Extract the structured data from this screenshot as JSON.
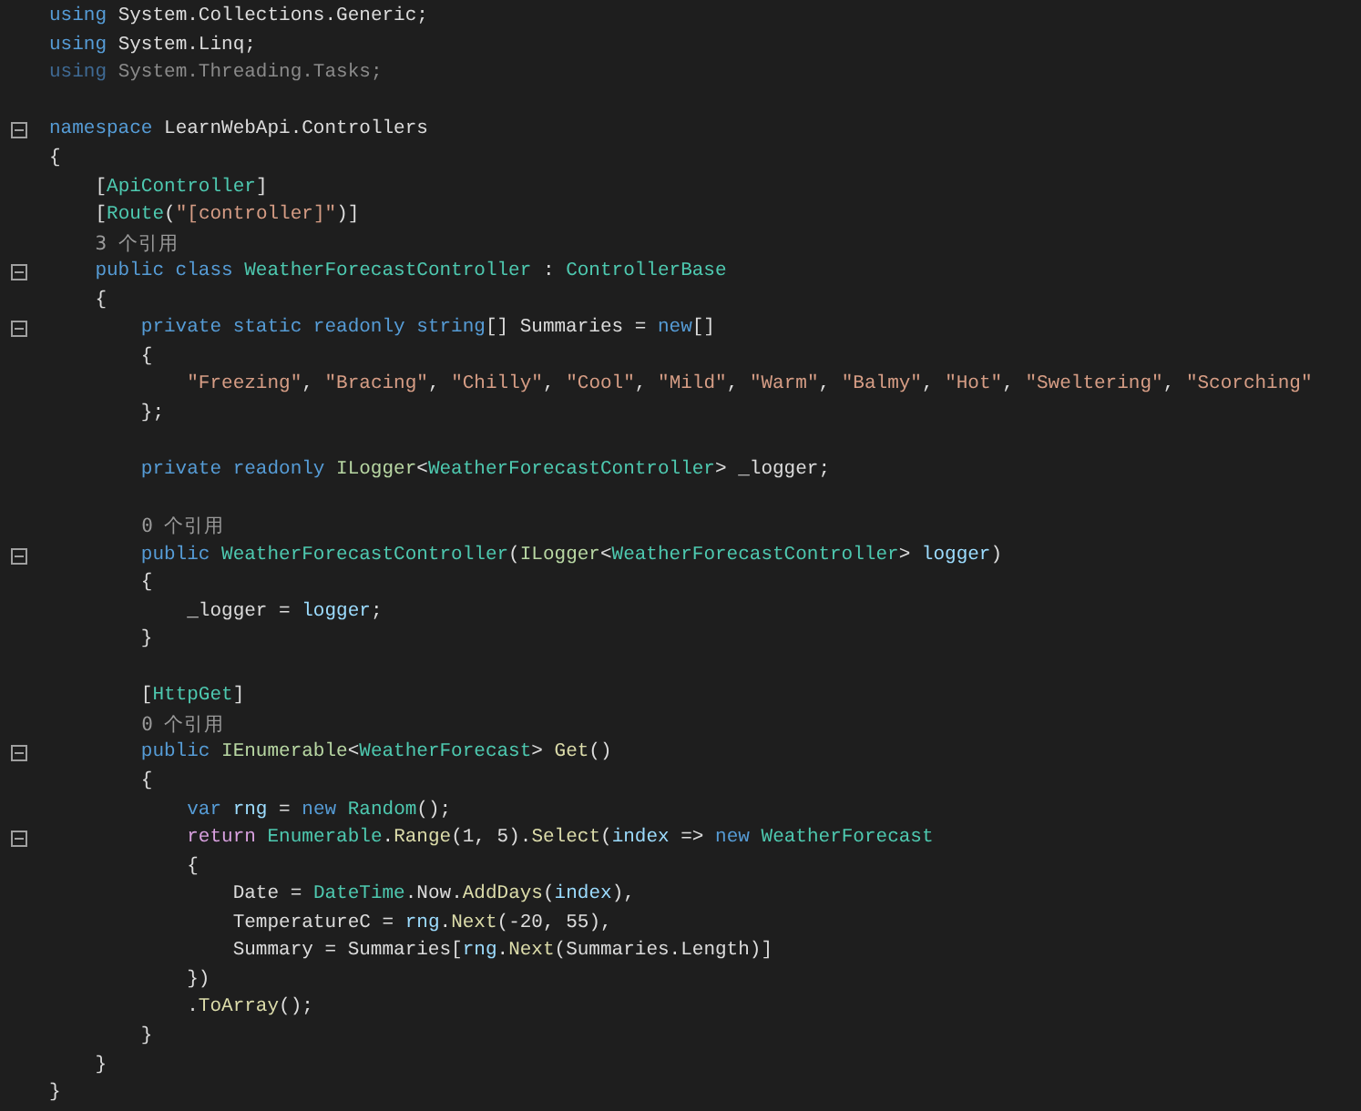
{
  "editor": {
    "lines": [
      {
        "kind": "code",
        "fold": false,
        "tokens": [
          {
            "text": "using",
            "kind": "kw"
          },
          {
            "text": " System.Collections.Generic;",
            "kind": "plain"
          }
        ]
      },
      {
        "kind": "code",
        "fold": false,
        "tokens": [
          {
            "text": "using",
            "kind": "kw"
          },
          {
            "text": " System.Linq;",
            "kind": "plain"
          }
        ]
      },
      {
        "kind": "code",
        "fold": false,
        "tokens": [
          {
            "text": "using",
            "kind": "dimkw"
          },
          {
            "text": " System.Threading.Tasks;",
            "kind": "dim"
          }
        ]
      },
      {
        "kind": "blank",
        "fold": false
      },
      {
        "kind": "code",
        "fold": true,
        "tokens": [
          {
            "text": "namespace",
            "kind": "kw"
          },
          {
            "text": " LearnWebApi.Controllers",
            "kind": "plain"
          }
        ]
      },
      {
        "kind": "code",
        "fold": false,
        "tokens": [
          {
            "text": "{",
            "kind": "plain"
          }
        ]
      },
      {
        "kind": "code",
        "fold": false,
        "tokens": [
          {
            "text": "    [",
            "kind": "plain"
          },
          {
            "text": "ApiController",
            "kind": "type"
          },
          {
            "text": "]",
            "kind": "plain"
          }
        ]
      },
      {
        "kind": "code",
        "fold": false,
        "tokens": [
          {
            "text": "    [",
            "kind": "plain"
          },
          {
            "text": "Route",
            "kind": "type"
          },
          {
            "text": "(",
            "kind": "plain"
          },
          {
            "text": "\"[controller]\"",
            "kind": "str"
          },
          {
            "text": ")]",
            "kind": "plain"
          }
        ]
      },
      {
        "kind": "codelens",
        "fold": false,
        "text": "    3 个引用"
      },
      {
        "kind": "code",
        "fold": true,
        "tokens": [
          {
            "text": "    public class ",
            "kind": "kw"
          },
          {
            "text": "WeatherForecastController",
            "kind": "type"
          },
          {
            "text": " : ",
            "kind": "plain"
          },
          {
            "text": "ControllerBase",
            "kind": "type"
          }
        ]
      },
      {
        "kind": "code",
        "fold": false,
        "tokens": [
          {
            "text": "    {",
            "kind": "plain"
          }
        ]
      },
      {
        "kind": "code",
        "fold": true,
        "tokens": [
          {
            "text": "        private static readonly string",
            "kind": "kw"
          },
          {
            "text": "[] Summaries = ",
            "kind": "plain"
          },
          {
            "text": "new",
            "kind": "kw"
          },
          {
            "text": "[]",
            "kind": "plain"
          }
        ]
      },
      {
        "kind": "code",
        "fold": false,
        "tokens": [
          {
            "text": "        {",
            "kind": "plain"
          }
        ]
      },
      {
        "kind": "code",
        "fold": false,
        "tokens": [
          {
            "text": "            \"Freezing\"",
            "kind": "str"
          },
          {
            "text": ", ",
            "kind": "plain"
          },
          {
            "text": "\"Bracing\"",
            "kind": "str"
          },
          {
            "text": ", ",
            "kind": "plain"
          },
          {
            "text": "\"Chilly\"",
            "kind": "str"
          },
          {
            "text": ", ",
            "kind": "plain"
          },
          {
            "text": "\"Cool\"",
            "kind": "str"
          },
          {
            "text": ", ",
            "kind": "plain"
          },
          {
            "text": "\"Mild\"",
            "kind": "str"
          },
          {
            "text": ", ",
            "kind": "plain"
          },
          {
            "text": "\"Warm\"",
            "kind": "str"
          },
          {
            "text": ", ",
            "kind": "plain"
          },
          {
            "text": "\"Balmy\"",
            "kind": "str"
          },
          {
            "text": ", ",
            "kind": "plain"
          },
          {
            "text": "\"Hot\"",
            "kind": "str"
          },
          {
            "text": ", ",
            "kind": "plain"
          },
          {
            "text": "\"Sweltering\"",
            "kind": "str"
          },
          {
            "text": ", ",
            "kind": "plain"
          },
          {
            "text": "\"Scorching\"",
            "kind": "str"
          }
        ]
      },
      {
        "kind": "code",
        "fold": false,
        "tokens": [
          {
            "text": "        };",
            "kind": "plain"
          }
        ]
      },
      {
        "kind": "blank",
        "fold": false
      },
      {
        "kind": "code",
        "fold": false,
        "tokens": [
          {
            "text": "        private readonly ",
            "kind": "kw"
          },
          {
            "text": "ILogger",
            "kind": "iface"
          },
          {
            "text": "<",
            "kind": "plain"
          },
          {
            "text": "WeatherForecastController",
            "kind": "type"
          },
          {
            "text": "> _logger;",
            "kind": "plain"
          }
        ]
      },
      {
        "kind": "blank",
        "fold": false
      },
      {
        "kind": "codelens",
        "fold": false,
        "text": "        0 个引用"
      },
      {
        "kind": "code",
        "fold": true,
        "tokens": [
          {
            "text": "        public ",
            "kind": "kw"
          },
          {
            "text": "WeatherForecastController",
            "kind": "type"
          },
          {
            "text": "(",
            "kind": "plain"
          },
          {
            "text": "ILogger",
            "kind": "iface"
          },
          {
            "text": "<",
            "kind": "plain"
          },
          {
            "text": "WeatherForecastController",
            "kind": "type"
          },
          {
            "text": "> ",
            "kind": "plain"
          },
          {
            "text": "logger",
            "kind": "param"
          },
          {
            "text": ")",
            "kind": "plain"
          }
        ]
      },
      {
        "kind": "code",
        "fold": false,
        "tokens": [
          {
            "text": "        {",
            "kind": "plain"
          }
        ]
      },
      {
        "kind": "code",
        "fold": false,
        "tokens": [
          {
            "text": "            _logger = ",
            "kind": "plain"
          },
          {
            "text": "logger",
            "kind": "param"
          },
          {
            "text": ";",
            "kind": "plain"
          }
        ]
      },
      {
        "kind": "code",
        "fold": false,
        "tokens": [
          {
            "text": "        }",
            "kind": "plain"
          }
        ]
      },
      {
        "kind": "blank",
        "fold": false
      },
      {
        "kind": "code",
        "fold": false,
        "tokens": [
          {
            "text": "        [",
            "kind": "plain"
          },
          {
            "text": "HttpGet",
            "kind": "type"
          },
          {
            "text": "]",
            "kind": "plain"
          }
        ]
      },
      {
        "kind": "codelens",
        "fold": false,
        "text": "        0 个引用"
      },
      {
        "kind": "code",
        "fold": true,
        "tokens": [
          {
            "text": "        public ",
            "kind": "kw"
          },
          {
            "text": "IEnumerable",
            "kind": "iface"
          },
          {
            "text": "<",
            "kind": "plain"
          },
          {
            "text": "WeatherForecast",
            "kind": "type"
          },
          {
            "text": "> ",
            "kind": "plain"
          },
          {
            "text": "Get",
            "kind": "method"
          },
          {
            "text": "()",
            "kind": "plain"
          }
        ]
      },
      {
        "kind": "code",
        "fold": false,
        "tokens": [
          {
            "text": "        {",
            "kind": "plain"
          }
        ]
      },
      {
        "kind": "code",
        "fold": false,
        "tokens": [
          {
            "text": "            var ",
            "kind": "kw"
          },
          {
            "text": "rng",
            "kind": "param"
          },
          {
            "text": " = ",
            "kind": "plain"
          },
          {
            "text": "new ",
            "kind": "kw"
          },
          {
            "text": "Random",
            "kind": "type"
          },
          {
            "text": "();",
            "kind": "plain"
          }
        ]
      },
      {
        "kind": "code",
        "fold": true,
        "tokens": [
          {
            "text": "            return ",
            "kind": "ctrl"
          },
          {
            "text": "Enumerable",
            "kind": "type"
          },
          {
            "text": ".",
            "kind": "plain"
          },
          {
            "text": "Range",
            "kind": "method"
          },
          {
            "text": "(1, 5).",
            "kind": "plain"
          },
          {
            "text": "Select",
            "kind": "method"
          },
          {
            "text": "(",
            "kind": "plain"
          },
          {
            "text": "index",
            "kind": "param"
          },
          {
            "text": " => ",
            "kind": "plain"
          },
          {
            "text": "new ",
            "kind": "kw"
          },
          {
            "text": "WeatherForecast",
            "kind": "type"
          }
        ]
      },
      {
        "kind": "code",
        "fold": false,
        "tokens": [
          {
            "text": "            {",
            "kind": "plain"
          }
        ]
      },
      {
        "kind": "code",
        "fold": false,
        "tokens": [
          {
            "text": "                Date = ",
            "kind": "plain"
          },
          {
            "text": "DateTime",
            "kind": "type"
          },
          {
            "text": ".Now.",
            "kind": "plain"
          },
          {
            "text": "AddDays",
            "kind": "method"
          },
          {
            "text": "(",
            "kind": "plain"
          },
          {
            "text": "index",
            "kind": "param"
          },
          {
            "text": "),",
            "kind": "plain"
          }
        ]
      },
      {
        "kind": "code",
        "fold": false,
        "tokens": [
          {
            "text": "                TemperatureC = ",
            "kind": "plain"
          },
          {
            "text": "rng",
            "kind": "param"
          },
          {
            "text": ".",
            "kind": "plain"
          },
          {
            "text": "Next",
            "kind": "method"
          },
          {
            "text": "(-20, 55),",
            "kind": "plain"
          }
        ]
      },
      {
        "kind": "code",
        "fold": false,
        "tokens": [
          {
            "text": "                Summary = Summaries[",
            "kind": "plain"
          },
          {
            "text": "rng",
            "kind": "param"
          },
          {
            "text": ".",
            "kind": "plain"
          },
          {
            "text": "Next",
            "kind": "method"
          },
          {
            "text": "(Summaries.Length)]",
            "kind": "plain"
          }
        ]
      },
      {
        "kind": "code",
        "fold": false,
        "tokens": [
          {
            "text": "            })",
            "kind": "plain"
          }
        ]
      },
      {
        "kind": "code",
        "fold": false,
        "tokens": [
          {
            "text": "            .",
            "kind": "plain"
          },
          {
            "text": "ToArray",
            "kind": "method"
          },
          {
            "text": "();",
            "kind": "plain"
          }
        ]
      },
      {
        "kind": "code",
        "fold": false,
        "tokens": [
          {
            "text": "        }",
            "kind": "plain"
          }
        ]
      },
      {
        "kind": "code",
        "fold": false,
        "tokens": [
          {
            "text": "    }",
            "kind": "plain"
          }
        ]
      },
      {
        "kind": "code",
        "fold": false,
        "tokens": [
          {
            "text": "}",
            "kind": "plain"
          }
        ]
      }
    ]
  }
}
